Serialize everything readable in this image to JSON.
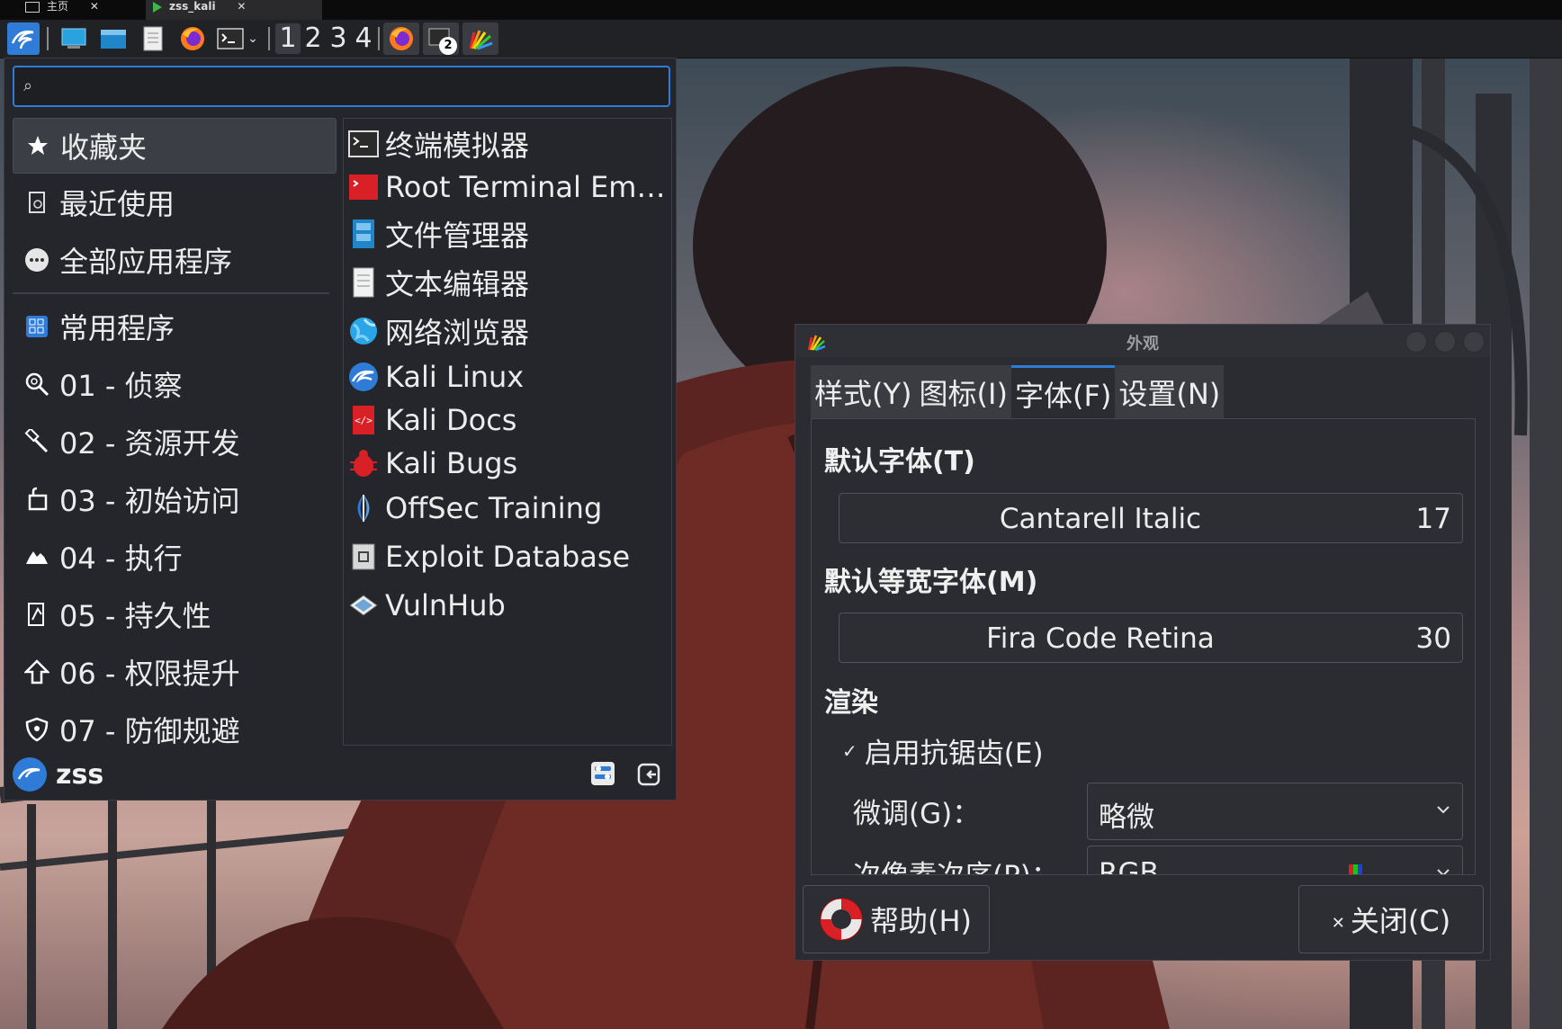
{
  "host_tabs": [
    {
      "label": "主页",
      "icon": "home-icon"
    },
    {
      "label": "zss_kali",
      "icon": "vm-icon"
    }
  ],
  "panel": {
    "workspaces": [
      "1",
      "2",
      "3",
      "4"
    ],
    "active_workspace": "1",
    "task_badge": "2",
    "launchers": [
      "kali-menu-icon",
      "desktop-icon",
      "file-manager-icon",
      "text-editor-icon",
      "firefox-icon",
      "terminal-icon"
    ]
  },
  "menu": {
    "search_placeholder": "",
    "categories": [
      {
        "label": "收藏夹",
        "icon": "star-icon",
        "selected": true
      },
      {
        "label": "最近使用",
        "icon": "recent-document-icon"
      },
      {
        "label": "全部应用程序",
        "icon": "all-apps-icon"
      },
      {
        "label": "常用程序",
        "icon": "grid-icon"
      },
      {
        "label": "01 - 侦察",
        "icon": "magnifier-icon"
      },
      {
        "label": "02 - 资源开发",
        "icon": "hammer-icon"
      },
      {
        "label": "03 - 初始访问",
        "icon": "access-icon"
      },
      {
        "label": "04 - 执行",
        "icon": "execute-icon"
      },
      {
        "label": "05 - 持久性",
        "icon": "persistence-icon"
      },
      {
        "label": "06 - 权限提升",
        "icon": "arrow-up-icon"
      },
      {
        "label": "07 - 防御规避",
        "icon": "shield-icon"
      }
    ],
    "apps": [
      {
        "label": "终端模拟器",
        "icon": "terminal-icon"
      },
      {
        "label": "Root Terminal Em…",
        "icon": "root-terminal-icon"
      },
      {
        "label": "文件管理器",
        "icon": "file-manager-icon"
      },
      {
        "label": "文本编辑器",
        "icon": "text-editor-icon"
      },
      {
        "label": "网络浏览器",
        "icon": "web-browser-icon"
      },
      {
        "label": "Kali Linux",
        "icon": "kali-dragon-icon"
      },
      {
        "label": "Kali Docs",
        "icon": "kali-docs-icon"
      },
      {
        "label": "Kali Bugs",
        "icon": "bug-icon"
      },
      {
        "label": "OffSec Training",
        "icon": "offsec-icon"
      },
      {
        "label": "Exploit Database",
        "icon": "exploit-db-icon"
      },
      {
        "label": "VulnHub",
        "icon": "vulnhub-icon"
      }
    ],
    "user": "zss"
  },
  "dialog": {
    "title": "外观",
    "tabs": [
      "样式(Y)",
      "图标(I)",
      "字体(F)",
      "设置(N)"
    ],
    "active_tab": "字体(F)",
    "default_font_label": "默认字体(T)",
    "default_font": {
      "name": "Cantarell Italic",
      "size": "17"
    },
    "mono_font_label": "默认等宽字体(M)",
    "mono_font": {
      "name": "Fira Code Retina",
      "size": "30"
    },
    "render_label": "渲染",
    "antialias_label": "启用抗锯齿(E)",
    "antialias_checked": true,
    "hinting_label": "微调(G)：",
    "hinting_value": "略微",
    "subpixel_label": "次像素次序(P)：",
    "subpixel_value": "RGB",
    "help_button": "帮助(H)",
    "close_button": "关闭(C)"
  },
  "colors": {
    "accent": "#2f7bd8",
    "panel_bg": "#202226",
    "menu_bg": "#24262b",
    "dialog_bg": "#2a2c31"
  }
}
